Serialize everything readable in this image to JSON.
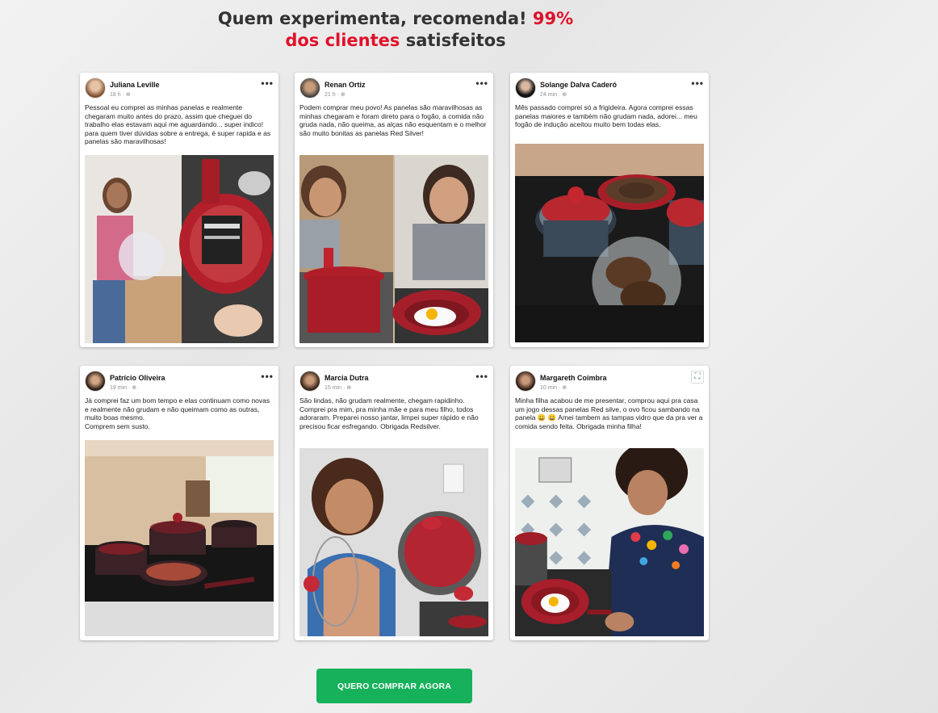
{
  "headline": {
    "part1": "Quem experimenta, recomenda! ",
    "part2": "99%",
    "part3": "dos clientes",
    "part4": " satisfeitos"
  },
  "reviews": [
    {
      "name": "Juliana Leville",
      "time": "18 h · ",
      "text": "Pessoal eu comprei as minhas panelas e realmente chegaram muito antes do prazo, assim que cheguei do trabalho elas estavam aqui me aguardando... super indico! para quem tiver dúvidas sobre a entrega, é super rapida e as panelas são maravilhosas!",
      "menu": "•••"
    },
    {
      "name": "Renan Ortiz",
      "time": "21 h · ",
      "text": "Podem comprar meu povo! As panelas são maravilhosas as minhas chegaram e foram direto para o fogão, a comida não gruda nada, não queima, as alças não esquentam e o melhor são muito bonitas as panelas Red Silver!",
      "menu": "•••"
    },
    {
      "name": "Solange Dalva Caderó",
      "time": "24 min · ",
      "text": "Mês passado comprei só a frigideira. Agora comprei essas panelas maiores e também não grudam nada, adorei... meu fogão de indução aceitou muito bem todas elas.",
      "menu": "•••"
    },
    {
      "name": "Patrício Oliveira",
      "time": "19 min · ",
      "text": "Já comprei faz um bom tempo e elas continuam como novas e realmente não grudam e não queimam como as outras, muito boas mesmo.\nComprem sem susto.",
      "menu": "•••"
    },
    {
      "name": "Marcia Dutra",
      "time": "15 min · ",
      "text": "São lindas, não grudam realmente, chegam rapidinho. Comprei pra mim, pra minha mãe e para meu filho, todos adoraram. Preparei nosso jantar, limpei super rápido e não precisou ficar esfregando. Obrigada Redsilver.",
      "menu": "•••"
    },
    {
      "name": "Margareth Coimbra",
      "time": "10 min · ",
      "text": "Minha filha acabou de me presentar, comprou aqui pra casa um jogo dessas panelas Red silve, o ovo ficou sambando na panela 😀 😀 Amei tambem as tampas vidro que da pra ver a comida sendo feita. Obrigada minha filha!",
      "menu": "⛶"
    }
  ],
  "cta": {
    "label": "QUERO COMPRAR AGORA"
  },
  "colors": {
    "accent_red": "#e0102a",
    "cta_green": "#17b15c",
    "text_dark": "#333333"
  },
  "icons": {
    "post_menu": "more-horiz-icon",
    "globe": "globe-icon",
    "scan": "scan-icon"
  }
}
